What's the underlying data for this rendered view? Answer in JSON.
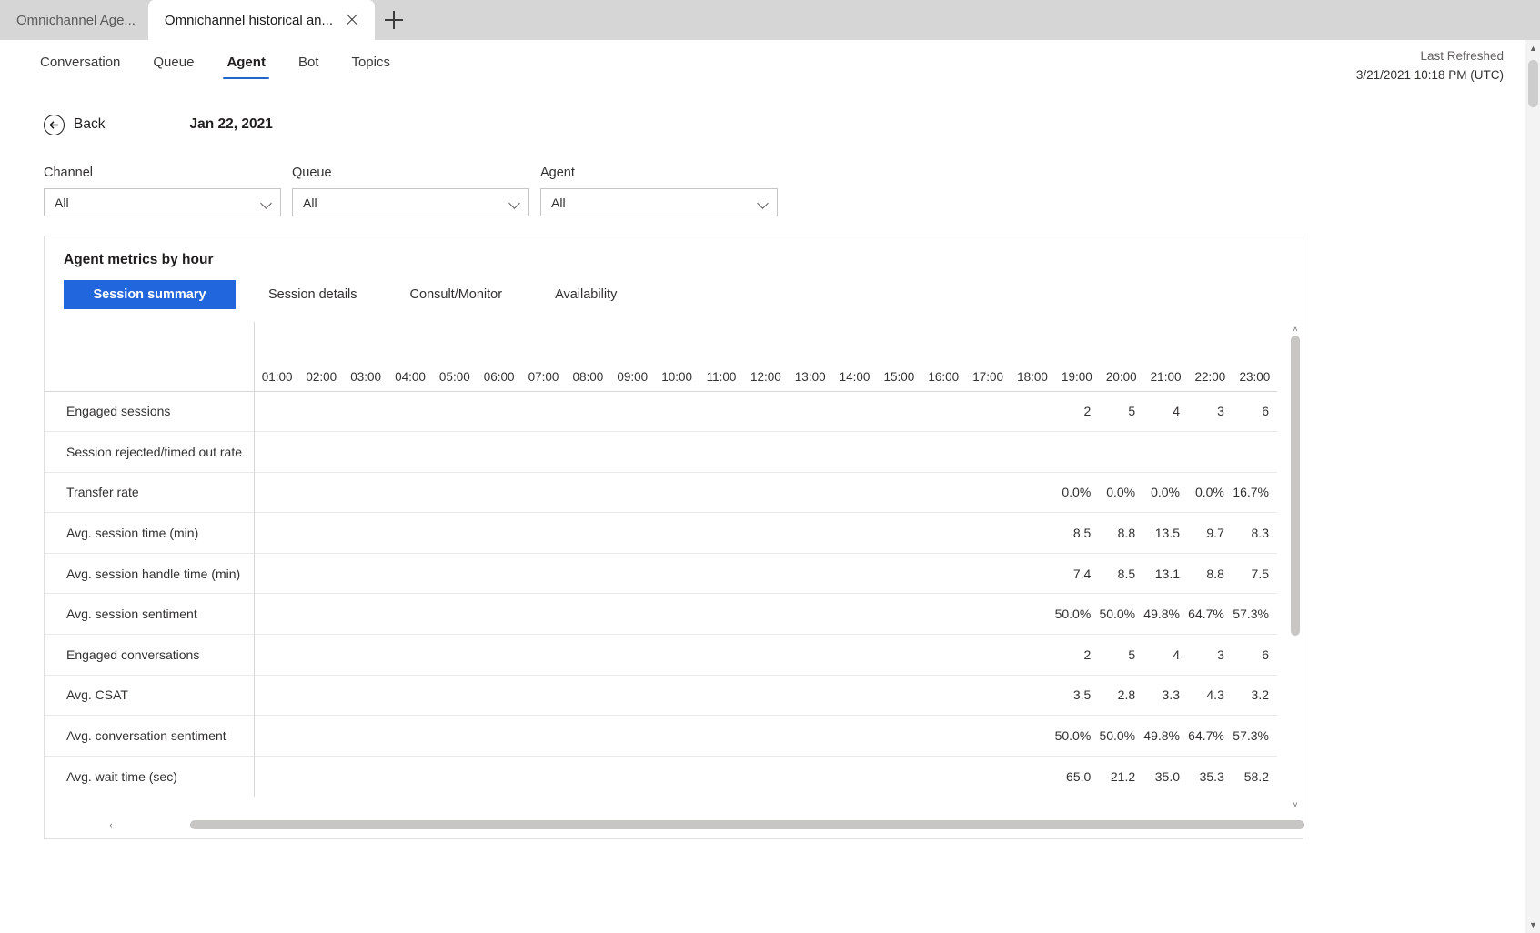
{
  "browser": {
    "tabs": [
      {
        "title": "Omnichannel Age...",
        "active": false
      },
      {
        "title": "Omnichannel historical an...",
        "active": true
      }
    ],
    "new_tab_label": "+",
    "close_label": "×"
  },
  "nav": {
    "items": [
      {
        "label": "Conversation",
        "selected": false
      },
      {
        "label": "Queue",
        "selected": false
      },
      {
        "label": "Agent",
        "selected": true
      },
      {
        "label": "Bot",
        "selected": false
      },
      {
        "label": "Topics",
        "selected": false
      }
    ]
  },
  "refresh": {
    "label": "Last Refreshed",
    "value": "3/21/2021 10:18 PM (UTC)"
  },
  "toolbar": {
    "back_label": "Back",
    "date_header": "Jan 22, 2021"
  },
  "filters": [
    {
      "label": "Channel",
      "value": "All"
    },
    {
      "label": "Queue",
      "value": "All"
    },
    {
      "label": "Agent",
      "value": "All"
    }
  ],
  "card": {
    "title": "Agent metrics by hour",
    "tabs": [
      {
        "label": "Session summary",
        "active": true
      },
      {
        "label": "Session details",
        "active": false
      },
      {
        "label": "Consult/Monitor",
        "active": false
      },
      {
        "label": "Availability",
        "active": false
      }
    ]
  },
  "table": {
    "row_header_label": "",
    "columns": [
      "01:00",
      "02:00",
      "03:00",
      "04:00",
      "05:00",
      "06:00",
      "07:00",
      "08:00",
      "09:00",
      "10:00",
      "11:00",
      "12:00",
      "13:00",
      "14:00",
      "15:00",
      "16:00",
      "17:00",
      "18:00",
      "19:00",
      "20:00",
      "21:00",
      "22:00",
      "23:00"
    ],
    "rows": [
      {
        "label": "Engaged sessions",
        "values": [
          "",
          "",
          "",
          "",
          "",
          "",
          "",
          "",
          "",
          "",
          "",
          "",
          "",
          "",
          "",
          "",
          "",
          "",
          "2",
          "5",
          "4",
          "3",
          "6"
        ]
      },
      {
        "label": "Session rejected/timed out rate",
        "values": [
          "",
          "",
          "",
          "",
          "",
          "",
          "",
          "",
          "",
          "",
          "",
          "",
          "",
          "",
          "",
          "",
          "",
          "",
          "",
          "",
          "",
          "",
          ""
        ]
      },
      {
        "label": "Transfer rate",
        "values": [
          "",
          "",
          "",
          "",
          "",
          "",
          "",
          "",
          "",
          "",
          "",
          "",
          "",
          "",
          "",
          "",
          "",
          "",
          "0.0%",
          "0.0%",
          "0.0%",
          "0.0%",
          "16.7%"
        ]
      },
      {
        "label": "Avg. session time (min)",
        "values": [
          "",
          "",
          "",
          "",
          "",
          "",
          "",
          "",
          "",
          "",
          "",
          "",
          "",
          "",
          "",
          "",
          "",
          "",
          "8.5",
          "8.8",
          "13.5",
          "9.7",
          "8.3"
        ]
      },
      {
        "label": "Avg. session handle time (min)",
        "values": [
          "",
          "",
          "",
          "",
          "",
          "",
          "",
          "",
          "",
          "",
          "",
          "",
          "",
          "",
          "",
          "",
          "",
          "",
          "7.4",
          "8.5",
          "13.1",
          "8.8",
          "7.5"
        ]
      },
      {
        "label": "Avg. session sentiment",
        "values": [
          "",
          "",
          "",
          "",
          "",
          "",
          "",
          "",
          "",
          "",
          "",
          "",
          "",
          "",
          "",
          "",
          "",
          "",
          "50.0%",
          "50.0%",
          "49.8%",
          "64.7%",
          "57.3%"
        ]
      },
      {
        "label": "Engaged conversations",
        "values": [
          "",
          "",
          "",
          "",
          "",
          "",
          "",
          "",
          "",
          "",
          "",
          "",
          "",
          "",
          "",
          "",
          "",
          "",
          "2",
          "5",
          "4",
          "3",
          "6"
        ]
      },
      {
        "label": "Avg. CSAT",
        "values": [
          "",
          "",
          "",
          "",
          "",
          "",
          "",
          "",
          "",
          "",
          "",
          "",
          "",
          "",
          "",
          "",
          "",
          "",
          "3.5",
          "2.8",
          "3.3",
          "4.3",
          "3.2"
        ]
      },
      {
        "label": "Avg. conversation sentiment",
        "values": [
          "",
          "",
          "",
          "",
          "",
          "",
          "",
          "",
          "",
          "",
          "",
          "",
          "",
          "",
          "",
          "",
          "",
          "",
          "50.0%",
          "50.0%",
          "49.8%",
          "64.7%",
          "57.3%"
        ]
      },
      {
        "label": "Avg. wait time (sec)",
        "values": [
          "",
          "",
          "",
          "",
          "",
          "",
          "",
          "",
          "",
          "",
          "",
          "",
          "",
          "",
          "",
          "",
          "",
          "",
          "65.0",
          "21.2",
          "35.0",
          "35.3",
          "58.2"
        ]
      }
    ]
  },
  "scrollbars": {
    "up_glyph": "▲",
    "down_glyph": "▼",
    "left_glyph": "‹",
    "right_glyph": "›",
    "small_up_glyph": "˄",
    "small_down_glyph": "˅"
  },
  "colors": {
    "accent": "#2266dd",
    "nav_underline": "#2266cc",
    "tabstrip_bg": "#d6d6d6",
    "border": "#e1dfdd"
  }
}
